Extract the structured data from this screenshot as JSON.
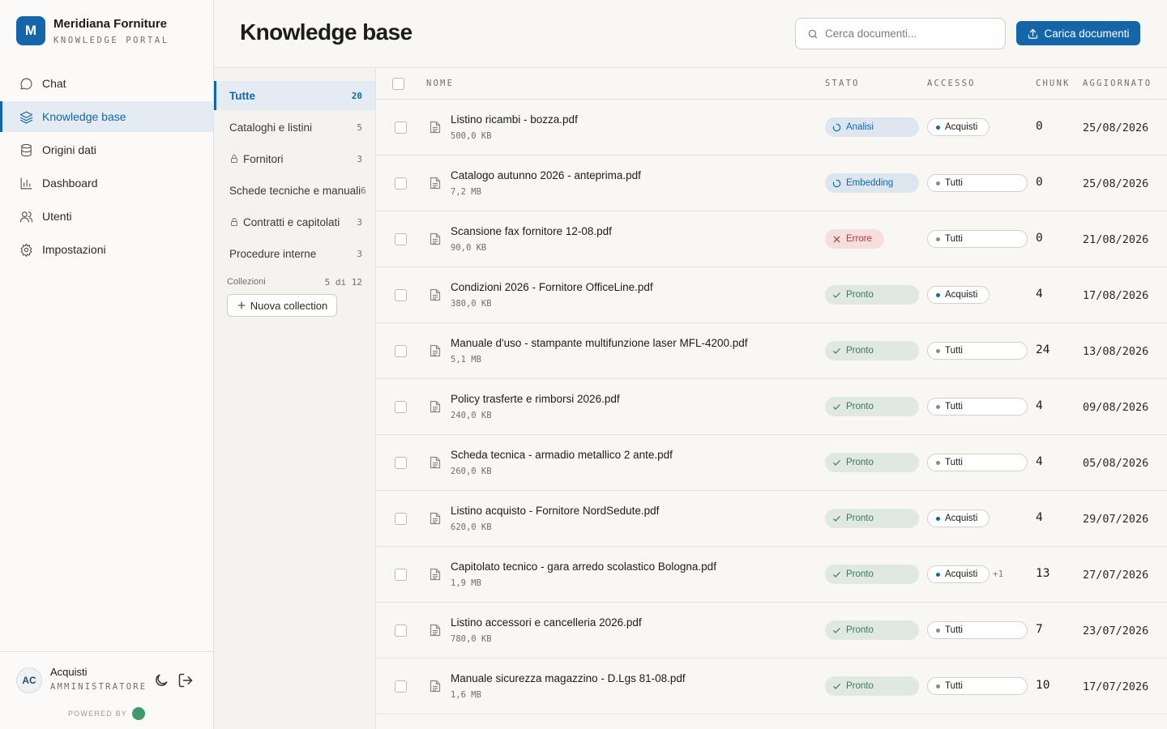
{
  "brand": {
    "logo_letter": "M",
    "name": "Meridiana Forniture",
    "subtitle": "KNOWLEDGE PORTAL",
    "accent": "#1466a8"
  },
  "nav": [
    {
      "label": "Chat",
      "icon": "chat-bubble-icon",
      "active": false
    },
    {
      "label": "Knowledge base",
      "icon": "layers-icon",
      "active": true
    },
    {
      "label": "Origini dati",
      "icon": "database-icon",
      "active": false
    },
    {
      "label": "Dashboard",
      "icon": "bar-chart-icon",
      "active": false
    },
    {
      "label": "Utenti",
      "icon": "users-icon",
      "active": false
    },
    {
      "label": "Impostazioni",
      "icon": "gear-icon",
      "active": false
    }
  ],
  "user": {
    "initials": "AC",
    "name": "Acquisti",
    "role": "AMMINISTRATORE"
  },
  "powered_by": "POWERED BY",
  "header": {
    "title": "Knowledge base",
    "search_placeholder": "Cerca documenti...",
    "upload_label": "Carica documenti"
  },
  "collections": {
    "items": [
      {
        "label": "Tutte",
        "count": "20",
        "locked": false,
        "active": true
      },
      {
        "label": "Cataloghi e listini",
        "count": "5",
        "locked": false,
        "active": false
      },
      {
        "label": "Fornitori",
        "count": "3",
        "locked": true,
        "active": false
      },
      {
        "label": "Schede tecniche e manuali",
        "count": "6",
        "locked": false,
        "active": false
      },
      {
        "label": "Contratti e capitolati",
        "count": "3",
        "locked": true,
        "active": false
      },
      {
        "label": "Procedure interne",
        "count": "3",
        "locked": false,
        "active": false
      }
    ],
    "meta_label": "Collezioni",
    "meta_count": "5 di 12",
    "new_label": "Nuova collection"
  },
  "table": {
    "columns": {
      "name": "NOME",
      "status": "STATO",
      "access": "ACCESSO",
      "chunk": "CHUNK",
      "updated": "AGGIORNATO"
    },
    "rows": [
      {
        "name": "Listino ricambi - bozza.pdf",
        "size": "500,0 KB",
        "status": "Analisi",
        "status_kind": "analisi",
        "access": "Acquisti",
        "access_kind": "acq",
        "extra": "",
        "chunk": "0",
        "updated": "25/08/2026"
      },
      {
        "name": "Catalogo autunno 2026 - anteprima.pdf",
        "size": "7,2 MB",
        "status": "Embedding",
        "status_kind": "embedding",
        "access": "Tutti",
        "access_kind": "tutti",
        "extra": "",
        "chunk": "0",
        "updated": "25/08/2026"
      },
      {
        "name": "Scansione fax fornitore 12-08.pdf",
        "size": "90,0 KB",
        "status": "Errore",
        "status_kind": "errore",
        "access": "Tutti",
        "access_kind": "tutti",
        "extra": "",
        "chunk": "0",
        "updated": "21/08/2026"
      },
      {
        "name": "Condizioni 2026 - Fornitore OfficeLine.pdf",
        "size": "380,0 KB",
        "status": "Pronto",
        "status_kind": "pronto",
        "access": "Acquisti",
        "access_kind": "acq",
        "extra": "",
        "chunk": "4",
        "updated": "17/08/2026"
      },
      {
        "name": "Manuale d'uso - stampante multifunzione laser MFL-4200.pdf",
        "size": "5,1 MB",
        "status": "Pronto",
        "status_kind": "pronto",
        "access": "Tutti",
        "access_kind": "tutti",
        "extra": "",
        "chunk": "24",
        "updated": "13/08/2026"
      },
      {
        "name": "Policy trasferte e rimborsi 2026.pdf",
        "size": "240,0 KB",
        "status": "Pronto",
        "status_kind": "pronto",
        "access": "Tutti",
        "access_kind": "tutti",
        "extra": "",
        "chunk": "4",
        "updated": "09/08/2026"
      },
      {
        "name": "Scheda tecnica - armadio metallico 2 ante.pdf",
        "size": "260,0 KB",
        "status": "Pronto",
        "status_kind": "pronto",
        "access": "Tutti",
        "access_kind": "tutti",
        "extra": "",
        "chunk": "4",
        "updated": "05/08/2026"
      },
      {
        "name": "Listino acquisto - Fornitore NordSedute.pdf",
        "size": "620,0 KB",
        "status": "Pronto",
        "status_kind": "pronto",
        "access": "Acquisti",
        "access_kind": "acq",
        "extra": "",
        "chunk": "4",
        "updated": "29/07/2026"
      },
      {
        "name": "Capitolato tecnico - gara arredo scolastico Bologna.pdf",
        "size": "1,9 MB",
        "status": "Pronto",
        "status_kind": "pronto",
        "access": "Acquisti",
        "access_kind": "acq",
        "extra": "+1",
        "chunk": "13",
        "updated": "27/07/2026"
      },
      {
        "name": "Listino accessori e cancelleria 2026.pdf",
        "size": "780,0 KB",
        "status": "Pronto",
        "status_kind": "pronto",
        "access": "Tutti",
        "access_kind": "tutti",
        "extra": "",
        "chunk": "7",
        "updated": "23/07/2026"
      },
      {
        "name": "Manuale sicurezza magazzino - D.Lgs 81-08.pdf",
        "size": "1,6 MB",
        "status": "Pronto",
        "status_kind": "pronto",
        "access": "Tutti",
        "access_kind": "tutti",
        "extra": "",
        "chunk": "10",
        "updated": "17/07/2026"
      }
    ]
  }
}
